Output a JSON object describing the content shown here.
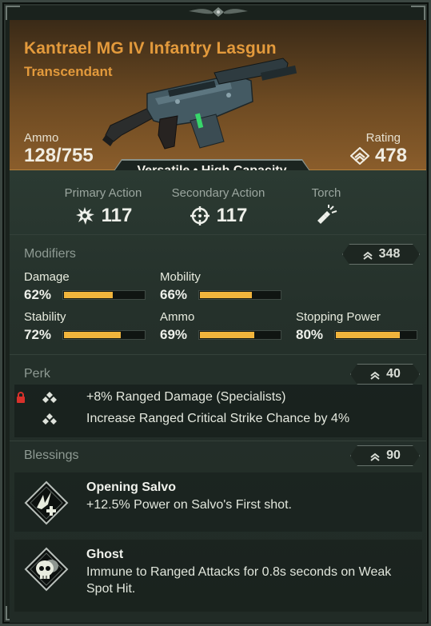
{
  "item": {
    "name": "Kantrael MG IV Infantry Lasgun",
    "rarity": "Transcendant",
    "ammo_label": "Ammo",
    "ammo_value": "128/755",
    "rating_label": "Rating",
    "rating_value": "478",
    "traits": "Versatile • High Capacity"
  },
  "actions": [
    {
      "label": "Primary Action",
      "value": "117",
      "icon": "impact-icon"
    },
    {
      "label": "Secondary Action",
      "value": "117",
      "icon": "crosshair-icon"
    },
    {
      "label": "Torch",
      "value": "",
      "icon": "flashlight-icon"
    }
  ],
  "modifiers": {
    "title": "Modifiers",
    "rating": "348",
    "stats": [
      {
        "name": "Damage",
        "percent": "62%",
        "value": 62
      },
      {
        "name": "Mobility",
        "percent": "66%",
        "value": 66
      },
      {
        "name": "Stability",
        "percent": "72%",
        "value": 72
      },
      {
        "name": "Ammo",
        "percent": "69%",
        "value": 69
      },
      {
        "name": "Stopping Power",
        "percent": "80%",
        "value": 80
      }
    ]
  },
  "perk": {
    "title": "Perk",
    "rating": "40",
    "lines": [
      "+8% Ranged Damage (Specialists)",
      "Increase Ranged Critical Strike Chance by 4%"
    ]
  },
  "blessings": {
    "title": "Blessings",
    "rating": "90",
    "items": [
      {
        "name": "Opening Salvo",
        "desc": "+12.5% Power on Salvo's First shot.",
        "icon": "salvo-icon"
      },
      {
        "name": "Ghost",
        "desc": "Immune to Ranged Attacks for 0.8s seconds on Weak Spot Hit.",
        "icon": "skull-icon"
      }
    ]
  },
  "colors": {
    "accent": "#e39a3c",
    "bar_fill": "#f1b43c",
    "lock": "#d8312b"
  }
}
